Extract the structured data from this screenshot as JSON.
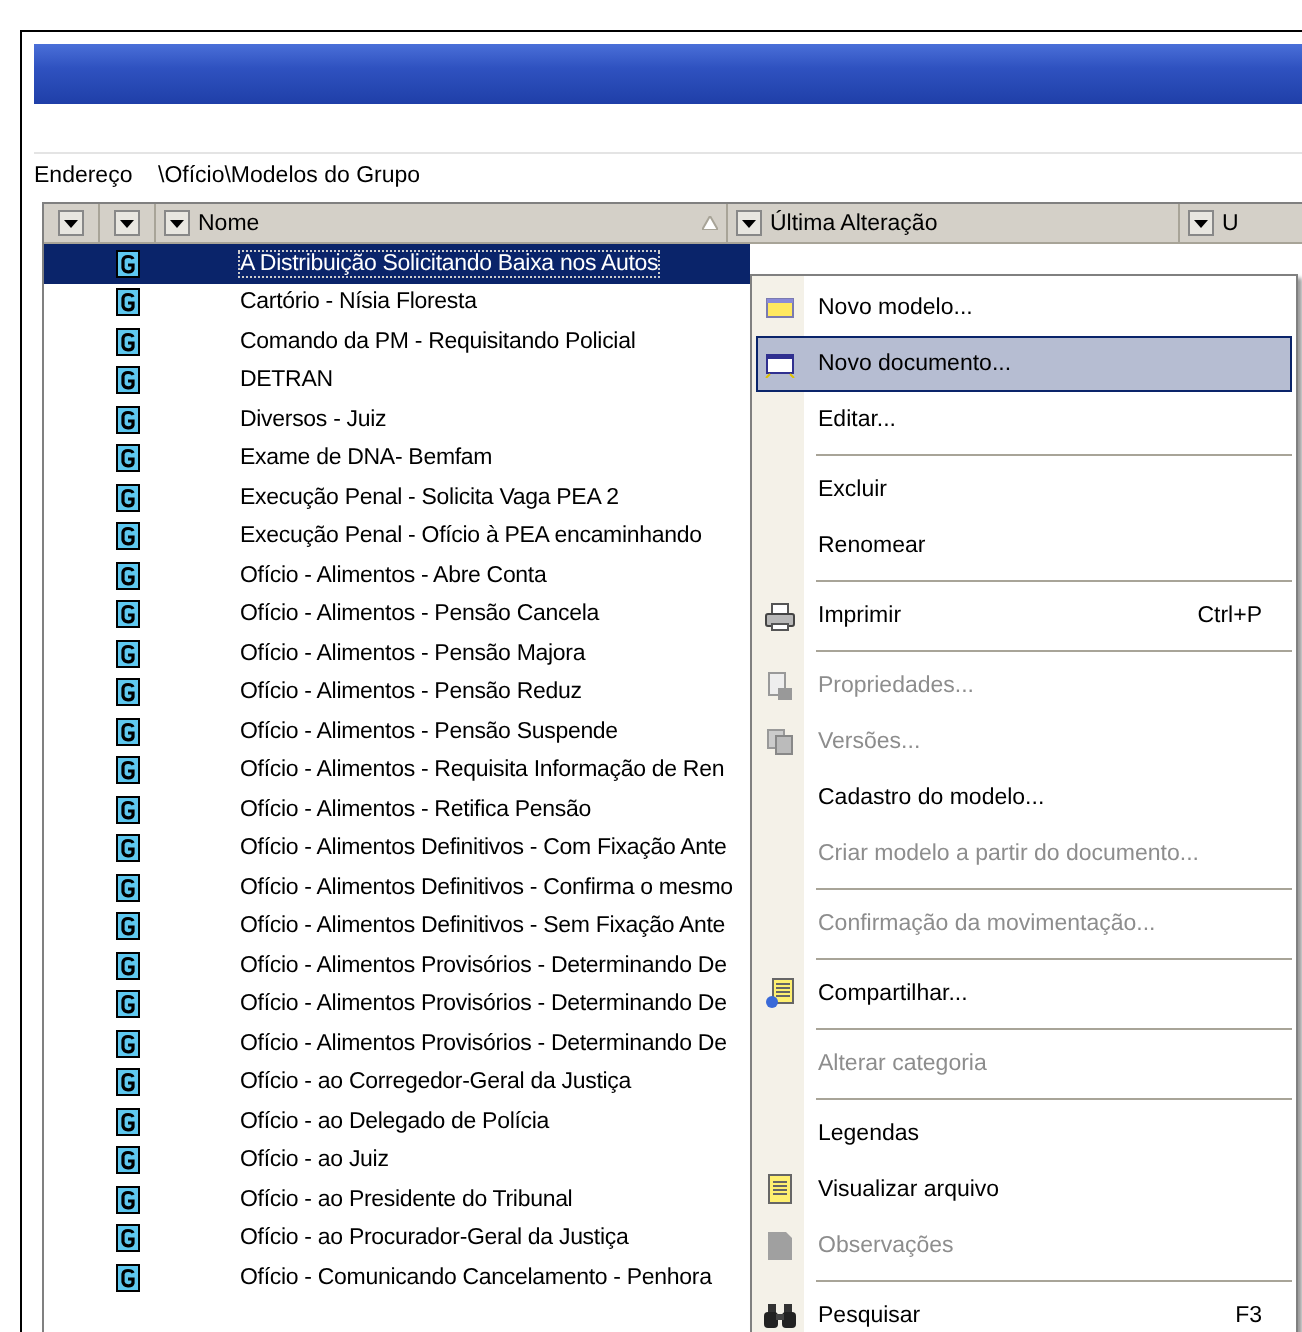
{
  "address": {
    "label": "Endereço",
    "value": "\\Ofício\\Modelos do Grupo"
  },
  "columns": [
    {
      "kind": "filter"
    },
    {
      "kind": "filter"
    },
    {
      "kind": "name",
      "label": "Nome",
      "sorted": true
    },
    {
      "kind": "date",
      "label": "Última Alteração"
    },
    {
      "kind": "cut",
      "label": "U"
    }
  ],
  "rows": [
    {
      "name": "A Distribuição Solicitando Baixa nos Autos",
      "selected": true
    },
    {
      "name": "Cartório - Nísia Floresta",
      "selected": false
    },
    {
      "name": "Comando da PM - Requisitando Policial",
      "selected": false
    },
    {
      "name": "DETRAN",
      "selected": false
    },
    {
      "name": "Diversos - Juiz",
      "selected": false
    },
    {
      "name": "Exame de DNA- Bemfam",
      "selected": false
    },
    {
      "name": "Execução Penal  - Solicita Vaga PEA 2",
      "selected": false
    },
    {
      "name": "Execução Penal - Ofício à PEA encaminhando",
      "selected": false
    },
    {
      "name": "Ofício - Alimentos - Abre Conta",
      "selected": false
    },
    {
      "name": "Ofício - Alimentos - Pensão Cancela",
      "selected": false
    },
    {
      "name": "Ofício - Alimentos - Pensão Majora",
      "selected": false
    },
    {
      "name": "Ofício - Alimentos - Pensão Reduz",
      "selected": false
    },
    {
      "name": "Ofício - Alimentos - Pensão Suspende",
      "selected": false
    },
    {
      "name": "Ofício - Alimentos - Requisita Informação de Ren",
      "selected": false
    },
    {
      "name": "Ofício - Alimentos - Retifica Pensão",
      "selected": false
    },
    {
      "name": "Ofício - Alimentos Definitivos - Com Fixação Ante",
      "selected": false
    },
    {
      "name": "Ofício - Alimentos Definitivos - Confirma o mesmo",
      "selected": false
    },
    {
      "name": "Ofício - Alimentos Definitivos - Sem Fixação Ante",
      "selected": false
    },
    {
      "name": "Ofício - Alimentos Provisórios - Determinando De",
      "selected": false
    },
    {
      "name": "Ofício - Alimentos Provisórios - Determinando De",
      "selected": false
    },
    {
      "name": "Ofício - Alimentos Provisórios - Determinando De",
      "selected": false
    },
    {
      "name": "Ofício - ao Corregedor-Geral da Justiça",
      "selected": false
    },
    {
      "name": "Ofício - ao Delegado de Polícia",
      "selected": false
    },
    {
      "name": "Ofício - ao Juiz",
      "selected": false
    },
    {
      "name": "Ofício - ao Presidente do Tribunal",
      "selected": false
    },
    {
      "name": "Ofício - ao Procurador-Geral da Justiça",
      "selected": false
    },
    {
      "name": "Ofício - Comunicando Cancelamento - Penhora",
      "selected": false
    }
  ],
  "menu": [
    {
      "kind": "item",
      "label": "Novo modelo...",
      "disabled": false,
      "selected": false
    },
    {
      "kind": "item",
      "label": "Novo documento...",
      "disabled": false,
      "selected": true
    },
    {
      "kind": "item",
      "label": "Editar...",
      "disabled": false,
      "selected": false
    },
    {
      "kind": "separator"
    },
    {
      "kind": "item",
      "label": "Excluir",
      "disabled": false,
      "selected": false
    },
    {
      "kind": "item",
      "label": "Renomear",
      "disabled": false,
      "selected": false
    },
    {
      "kind": "separator"
    },
    {
      "kind": "item",
      "label": "Imprimir",
      "shortcut": "Ctrl+P",
      "disabled": false,
      "selected": false
    },
    {
      "kind": "separator"
    },
    {
      "kind": "item",
      "label": "Propriedades...",
      "disabled": true,
      "selected": false
    },
    {
      "kind": "item",
      "label": "Versões...",
      "disabled": true,
      "selected": false
    },
    {
      "kind": "item",
      "label": "Cadastro do modelo...",
      "disabled": false,
      "selected": false
    },
    {
      "kind": "item",
      "label": "Criar modelo a partir do documento...",
      "disabled": true,
      "selected": false
    },
    {
      "kind": "separator"
    },
    {
      "kind": "item",
      "label": "Confirmação da movimentação...",
      "disabled": true,
      "selected": false
    },
    {
      "kind": "separator"
    },
    {
      "kind": "item",
      "label": "Compartilhar...",
      "disabled": false,
      "selected": false
    },
    {
      "kind": "separator"
    },
    {
      "kind": "item",
      "label": "Alterar categoria",
      "disabled": true,
      "selected": false
    },
    {
      "kind": "separator"
    },
    {
      "kind": "item",
      "label": "Legendas",
      "disabled": false,
      "selected": false
    },
    {
      "kind": "item",
      "label": "Visualizar arquivo",
      "disabled": false,
      "selected": false
    },
    {
      "kind": "item",
      "label": "Observações",
      "disabled": true,
      "selected": false
    },
    {
      "kind": "separator"
    },
    {
      "kind": "item",
      "label": "Pesquisar",
      "shortcut": "F3",
      "disabled": false,
      "selected": false
    }
  ]
}
